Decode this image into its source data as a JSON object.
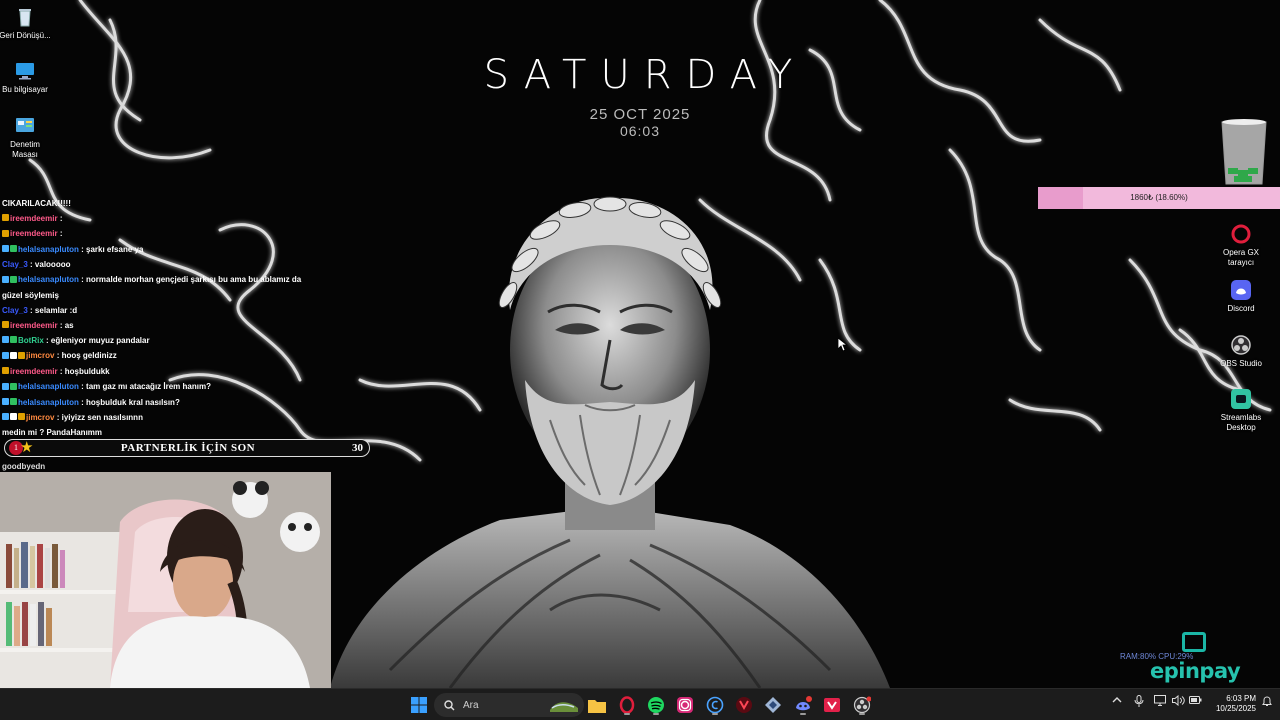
{
  "clock": {
    "day": "SATURDAY",
    "date": "25 OCT 2025",
    "time": "06:03"
  },
  "desktop_icons_left": [
    {
      "label": "Geri Dönüşü...",
      "icon": "recycle-bin-icon"
    },
    {
      "label": "Bu bilgisayar",
      "icon": "computer-icon"
    },
    {
      "label": "Denetim Masası",
      "icon": "control-panel-icon"
    }
  ],
  "desktop_icons_right": [
    {
      "label": "Opera GX tarayıcı",
      "icon": "opera-gx-icon"
    },
    {
      "label": "Discord",
      "icon": "discord-icon"
    },
    {
      "label": "OBS Studio",
      "icon": "obs-icon"
    },
    {
      "label": "Streamlabs Desktop",
      "icon": "streamlabs-icon"
    }
  ],
  "chat": {
    "top_text": "CIKARILACAK!!!!!",
    "messages": [
      {
        "user": "ireemdeemir",
        "msg": ":",
        "user_color": "#ff5a8a",
        "badges": [
          "#e0a000"
        ]
      },
      {
        "user": "ireemdeemir",
        "msg": ":",
        "user_color": "#ff5a8a",
        "badges": [
          "#e0a000"
        ]
      },
      {
        "user": "helalsanapluton",
        "msg": ": şarkı efsane ya",
        "user_color": "#3a8bff",
        "badges": [
          "#4ab0ff",
          "#30c060"
        ]
      },
      {
        "user": "Clay_3",
        "msg": ": valooooo",
        "user_color": "#3a5bff",
        "badges": []
      },
      {
        "user": "helalsanapluton",
        "msg": ": normalde morhan gençjedi şarkısı bu ama bu ablamız da",
        "user_color": "#3a8bff",
        "badges": [
          "#4ab0ff",
          "#30c060"
        ]
      },
      {
        "user": "",
        "msg": "güzel söylemiş",
        "user_color": "#ffffff",
        "badges": []
      },
      {
        "user": "Clay_3",
        "msg": ": selamlar :d",
        "user_color": "#3a5bff",
        "badges": []
      },
      {
        "user": "ireemdeemir",
        "msg": ": as",
        "user_color": "#ff5a8a",
        "badges": [
          "#e0a000"
        ]
      },
      {
        "user": "BotRix",
        "msg": ": eğleniyor muyuz pandalar",
        "user_color": "#30d090",
        "badges": [
          "#4ab0ff",
          "#30c060"
        ]
      },
      {
        "user": "jimcrov",
        "msg": ": hooş geldinizz",
        "user_color": "#ff8a40",
        "badges": [
          "#4ab0ff",
          "#ffffff",
          "#e0a000"
        ]
      },
      {
        "user": "ireemdeemir",
        "msg": ": hoşbuldukk",
        "user_color": "#ff5a8a",
        "badges": [
          "#e0a000"
        ]
      },
      {
        "user": "helalsanapluton",
        "msg": ": tam gaz mı atacağız İrem hanım?",
        "user_color": "#3a8bff",
        "badges": [
          "#4ab0ff",
          "#30c060"
        ]
      },
      {
        "user": "helalsanapluton",
        "msg": ": hoşbulduk kral nasılsın?",
        "user_color": "#3a8bff",
        "badges": [
          "#4ab0ff",
          "#30c060"
        ]
      },
      {
        "user": "jimcrov",
        "msg": ": iyiyizz sen nasılsınnn",
        "user_color": "#ff8a40",
        "badges": [
          "#4ab0ff",
          "#ffffff",
          "#e0a000"
        ]
      },
      {
        "user": "",
        "msg": "medin mi ? PandaHanımm",
        "user_color": "#ffffff",
        "badges": []
      }
    ],
    "bottom_text": "goodbyedn"
  },
  "partner_bar": {
    "left_number": "1",
    "title": "PARTNERLİK İÇİN SON",
    "right_number": "30"
  },
  "goal": {
    "text": "1860₺ (18.60%)",
    "progress": 0.186
  },
  "epinpay": {
    "brand": "epinpay"
  },
  "sysmon": {
    "text": "RAM:80%  CPU:29%"
  },
  "taskbar": {
    "search_placeholder": "Ara",
    "time": "6:03 PM",
    "date": "10/25/2025",
    "apps": [
      "windows-start-icon",
      "search-icon",
      "weather-widget-icon",
      "file-explorer-icon",
      "opera-gx-icon",
      "spotify-icon",
      "instagram-icon",
      "capcut-icon",
      "valorant-icon",
      "ccleaner-icon",
      "discord-icon",
      "vegas-icon",
      "obs-icon"
    ]
  },
  "colors": {
    "taskbar": "#1c1c1c",
    "goal_bar": "#f2b9dc",
    "epinpay": "#26c2ae",
    "accent_red": "#c0102a"
  }
}
